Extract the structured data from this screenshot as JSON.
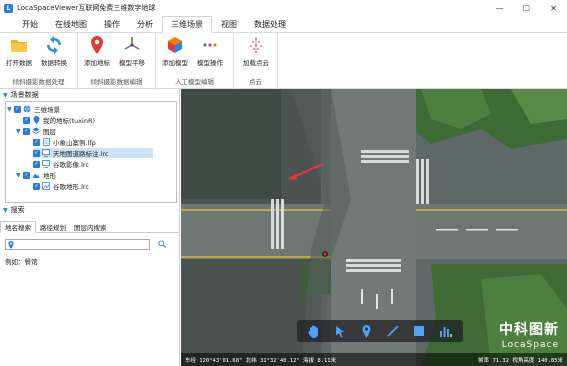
{
  "window": {
    "title": "LocaSpaceViewer互联网免费三维数字地球",
    "minimize": "—",
    "maximize": "☐",
    "close": "✕"
  },
  "menu": {
    "tabs": [
      "开始",
      "在线地图",
      "操作",
      "分析",
      "三维场景",
      "视图",
      "数据处理"
    ],
    "active_index": 4
  },
  "ribbon": {
    "groups": [
      {
        "label": "倾斜摄影数据处理",
        "buttons": [
          {
            "label": "打开数据",
            "icon": "folder-icon"
          },
          {
            "label": "数据转换",
            "icon": "convert-icon"
          }
        ]
      },
      {
        "label": "倾斜摄影数据编辑",
        "buttons": [
          {
            "label": "添加地标",
            "icon": "placemark-icon"
          },
          {
            "label": "模型平移",
            "icon": "move-model-icon"
          }
        ]
      },
      {
        "label": "人工模型编辑",
        "buttons": [
          {
            "label": "添加模型",
            "icon": "cube-icon"
          },
          {
            "label": "模型操作",
            "icon": "model-operate-icon"
          }
        ]
      },
      {
        "label": "点云",
        "buttons": [
          {
            "label": "加载点云",
            "icon": "pointcloud-icon"
          }
        ]
      }
    ]
  },
  "scene_panel": {
    "title": "场景数据",
    "tree": [
      {
        "label": "三维场景",
        "level": 0,
        "icon": "globe-icon"
      },
      {
        "label": "我的地标(tuxinR)",
        "level": 1,
        "icon": "placemark-icon"
      },
      {
        "label": "图层",
        "level": 1,
        "icon": "layers-icon"
      },
      {
        "label": "小象山案例.lfp",
        "level": 2,
        "icon": "file-icon"
      },
      {
        "label": "天地图道路标注.lrc",
        "level": 2,
        "icon": "monitor-icon",
        "selected": true
      },
      {
        "label": "谷歌影像.lrc",
        "level": 2,
        "icon": "monitor-icon"
      },
      {
        "label": "地形",
        "level": 1,
        "icon": "terrain-icon"
      },
      {
        "label": "谷歌地形.lrc",
        "level": 2,
        "icon": "terrain-file-icon"
      }
    ]
  },
  "search_panel": {
    "title": "搜索",
    "tabs": [
      "地名搜索",
      "路径规划",
      "图层内搜索"
    ],
    "input_value": "",
    "example": "例如：餐馆"
  },
  "viewport": {
    "tools": [
      "hand-icon",
      "pointer-icon",
      "placemark-icon",
      "line-icon",
      "rectangle-icon",
      "chart-icon"
    ],
    "brand_cn": "中科图新",
    "brand_en": "LocaSpace",
    "status_left": "东经 120°43'01.68\"  北纬 31°32'40.12\"  海拔 8.11米",
    "status_right": "帧率 71.32  视角高度 140.85米"
  }
}
